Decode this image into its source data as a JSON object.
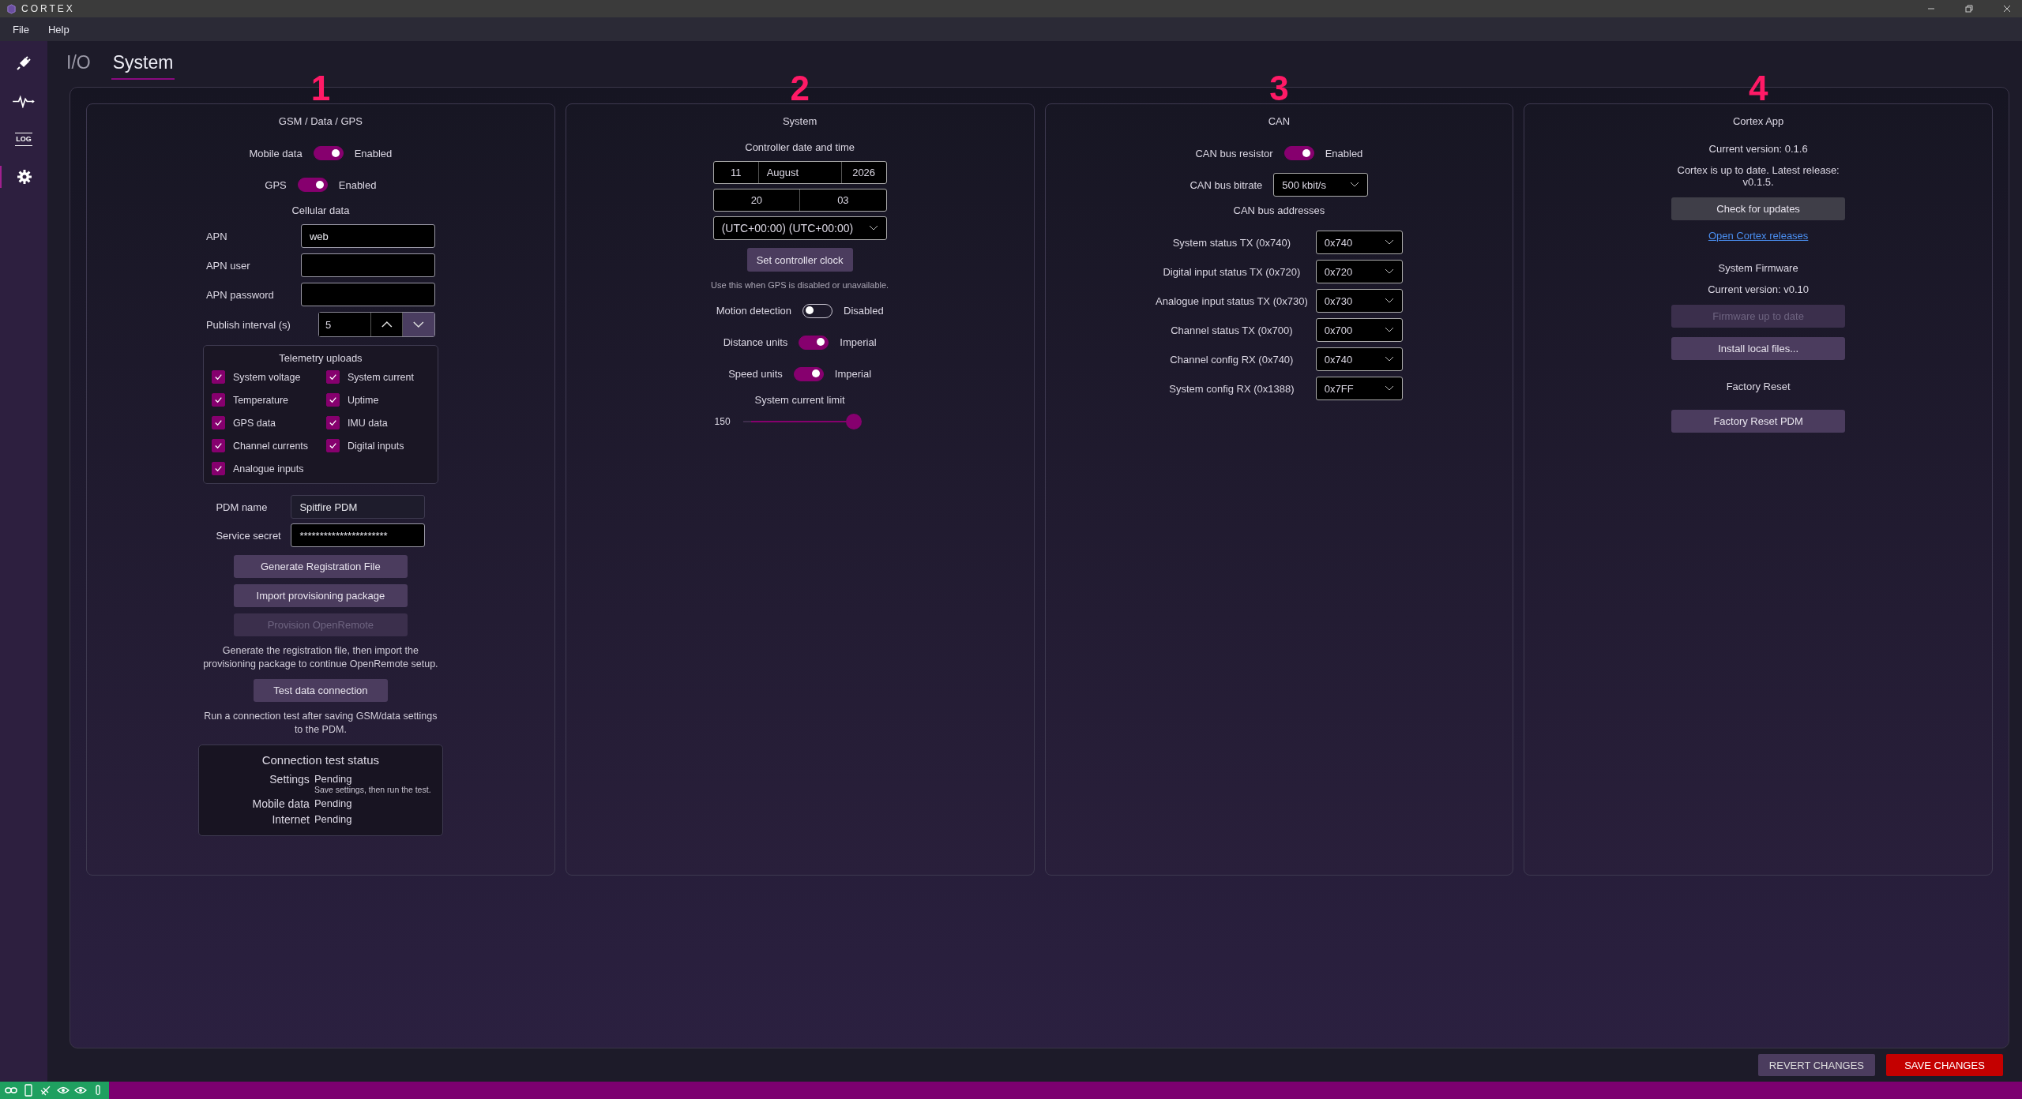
{
  "app": {
    "title": "CORTEX"
  },
  "menu": [
    "File",
    "Help"
  ],
  "sidebar": {
    "items": [
      {
        "kind": "plug",
        "selected": false
      },
      {
        "kind": "pulse",
        "selected": false
      },
      {
        "kind": "log",
        "label": "LOG",
        "selected": false
      },
      {
        "kind": "settings",
        "selected": true
      }
    ]
  },
  "tabs": [
    {
      "label": "I/O",
      "selected": false
    },
    {
      "label": "System",
      "selected": true
    }
  ],
  "gsm": {
    "marker": "1",
    "title": "GSM / Data / GPS",
    "toggles": [
      {
        "label": "Mobile data",
        "on": true,
        "state": "Enabled"
      },
      {
        "label": "GPS",
        "on": true,
        "state": "Enabled"
      }
    ],
    "cellular_title": "Cellular data",
    "fields": [
      {
        "label": "APN",
        "value": "web"
      },
      {
        "label": "APN user"
      },
      {
        "label": "APN password"
      }
    ],
    "publish_interval": {
      "label": "Publish interval (s)",
      "value": "5"
    },
    "telemetry": {
      "title": "Telemetry uploads",
      "items": [
        {
          "label": "System voltage",
          "checked": true
        },
        {
          "label": "System current",
          "checked": true
        },
        {
          "label": "Temperature",
          "checked": true
        },
        {
          "label": "Uptime",
          "checked": true
        },
        {
          "label": "GPS data",
          "checked": true
        },
        {
          "label": "IMU data",
          "checked": true
        },
        {
          "label": "Channel currents",
          "checked": true
        },
        {
          "label": "Digital inputs",
          "checked": true
        },
        {
          "label": "Analogue inputs",
          "checked": true
        }
      ]
    },
    "pdm_name": {
      "label": "PDM name",
      "value": "Spitfire PDM"
    },
    "service_secret": {
      "label": "Service secret",
      "value": "**********************"
    },
    "buttons": [
      {
        "label": "Generate Registration File",
        "disabled": false
      },
      {
        "label": "Import provisioning package",
        "disabled": false
      },
      {
        "label": "Provision OpenRemote",
        "disabled": true
      }
    ],
    "help": "Generate the registration file, then import the provisioning package to continue OpenRemote setup.",
    "test_button": "Test data connection",
    "test_help": "Run a connection test after saving GSM/data settings to the PDM.",
    "status": {
      "title": "Connection test status",
      "rows": [
        {
          "label": "Settings",
          "value": "Pending",
          "note": "Save settings, then run the test."
        },
        {
          "label": "Mobile data",
          "value": "Pending"
        },
        {
          "label": "Internet",
          "value": "Pending"
        }
      ]
    }
  },
  "system": {
    "marker": "2",
    "title": "System",
    "datetime_title": "Controller date and time",
    "date": [
      "11",
      "August",
      "2026"
    ],
    "time": [
      "20",
      "03"
    ],
    "timezone": "(UTC+00:00) (UTC+00:00)",
    "set_clock": "Set controller clock",
    "help": "Use this when GPS is disabled or unavailable.",
    "toggles": [
      {
        "label": "Motion detection",
        "on": false,
        "state": "Disabled"
      },
      {
        "label": "Distance units",
        "on": true,
        "state": "Imperial"
      },
      {
        "label": "Speed units",
        "on": true,
        "state": "Imperial"
      }
    ],
    "current_limit": {
      "title": "System current limit",
      "reading": "150",
      "level": 1
    }
  },
  "can": {
    "marker": "3",
    "title": "CAN",
    "toggles": [
      {
        "label": "CAN bus resistor",
        "on": true,
        "state": "Enabled"
      }
    ],
    "bitrate": {
      "label": "CAN bus bitrate",
      "value": "500 kbit/s"
    },
    "addresses_title": "CAN bus addresses",
    "addresses": [
      {
        "label": "System status TX (0x740)",
        "value": "0x740"
      },
      {
        "label": "Digital input status TX (0x720)",
        "value": "0x720"
      },
      {
        "label": "Analogue input status TX (0x730)",
        "value": "0x730"
      },
      {
        "label": "Channel status TX (0x700)",
        "value": "0x700"
      },
      {
        "label": "Channel config RX (0x740)",
        "value": "0x740"
      },
      {
        "label": "System config RX (0x1388)",
        "value": "0x7FF"
      }
    ]
  },
  "app_panel": {
    "marker": "4",
    "title": "Cortex App",
    "version": "Current version: 0.1.6",
    "update_status": "Cortex is up to date. Latest release: v0.1.5.",
    "check_button": "Check for updates",
    "releases_link": "Open Cortex releases",
    "firmware_title": "System Firmware",
    "firmware_version": "Current version: v0.10",
    "firmware_buttons": [
      {
        "label": "Firmware up to date",
        "disabled": true
      },
      {
        "label": "Install local files...",
        "disabled": false
      }
    ],
    "reset_title": "Factory Reset",
    "reset_button": "Factory Reset PDM"
  },
  "footer": {
    "buttons": [
      {
        "label": "REVERT CHANGES",
        "kind": "secondary"
      },
      {
        "label": "SAVE CHANGES",
        "kind": "primary"
      }
    ]
  }
}
